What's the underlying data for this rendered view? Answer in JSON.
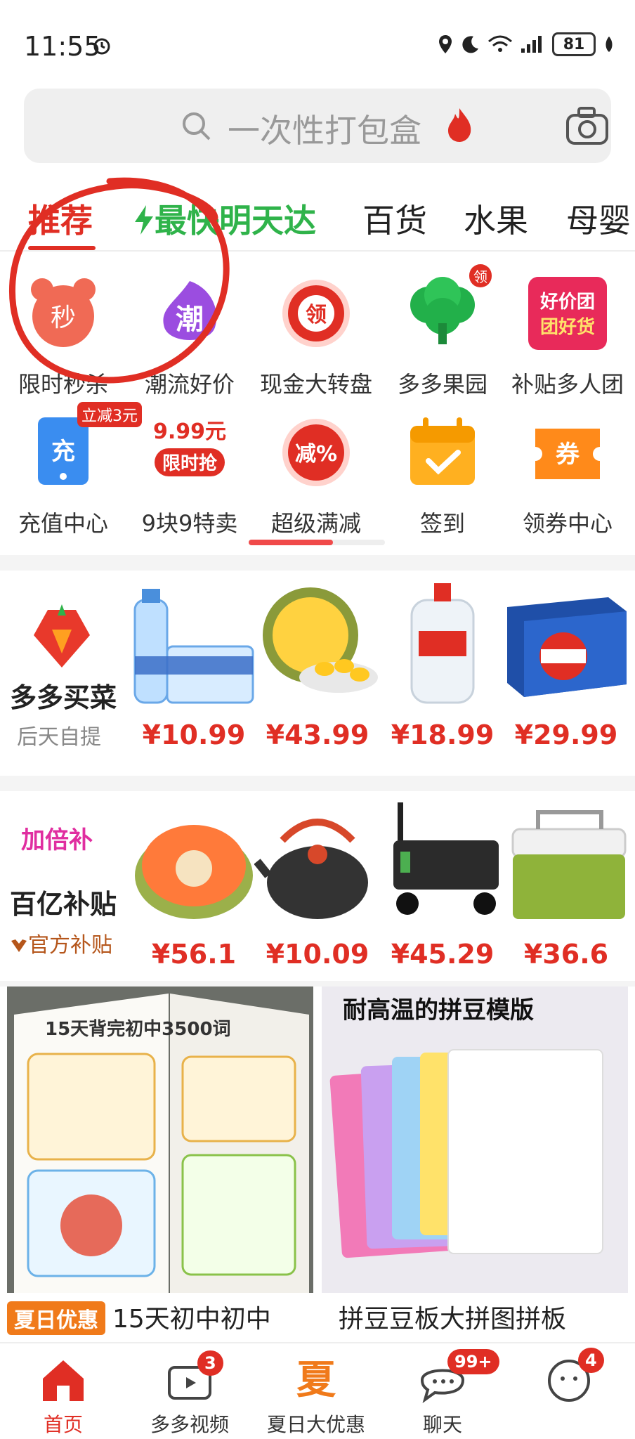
{
  "status_bar": {
    "time": "11:55",
    "battery": "81"
  },
  "search": {
    "placeholder": "一次性打包盒"
  },
  "tabs": [
    {
      "label": "推荐"
    },
    {
      "label": "最快明天达"
    },
    {
      "label": "百货"
    },
    {
      "label": "水果"
    },
    {
      "label": "母婴"
    }
  ],
  "grid_row1": [
    {
      "label": "限时秒杀",
      "icon": "seckill-clock-icon",
      "glyph": "秒"
    },
    {
      "label": "潮流好价",
      "icon": "trend-icon",
      "glyph": "潮"
    },
    {
      "label": "现金大转盘",
      "icon": "wheel-icon",
      "glyph": "领"
    },
    {
      "label": "多多果园",
      "icon": "tree-icon",
      "badge": "领"
    },
    {
      "label": "补贴多人团",
      "icon": "group-buy-icon",
      "glyph_line1": "好价团",
      "glyph_line2": "团好货"
    }
  ],
  "grid_row2": [
    {
      "label": "充值中心",
      "icon": "recharge-icon",
      "glyph": "充",
      "badge": "立减3元"
    },
    {
      "label": "9块9特卖",
      "icon": "sale-icon",
      "glyph_line1": "9.99元",
      "glyph_line2": "限时抢"
    },
    {
      "label": "超级满减",
      "icon": "discount-icon",
      "glyph": "减%"
    },
    {
      "label": "签到",
      "icon": "calendar-check-icon"
    },
    {
      "label": "领券中心",
      "icon": "coupon-icon",
      "glyph": "券"
    }
  ],
  "grocery_row": {
    "title": "多多买菜",
    "subtitle": "后天自提",
    "products": [
      {
        "price": "¥10.99",
        "icon": "water-bottles-icon"
      },
      {
        "price": "¥43.99",
        "icon": "jackfruit-icon"
      },
      {
        "price": "¥18.99",
        "icon": "water-jug-icon"
      },
      {
        "price": "¥29.99",
        "icon": "cola-box-icon"
      }
    ]
  },
  "subsidy_row": {
    "badge_text": "加倍补",
    "title": "百亿补贴",
    "subtitle": "官方补贴",
    "products": [
      {
        "price": "¥56.1",
        "icon": "jackfruit-cut-icon"
      },
      {
        "price": "¥10.09",
        "icon": "kettle-icon"
      },
      {
        "price": "¥45.29",
        "icon": "wagon-icon"
      },
      {
        "price": "¥36.6",
        "icon": "cooler-box-icon"
      }
    ]
  },
  "cards": [
    {
      "tag": "夏日优惠",
      "title": "15天初中初中",
      "image_text": "15天背完初中3500词"
    },
    {
      "tag": "",
      "title": "拼豆豆板大拼图拼板",
      "image_text": "耐高温的拼豆模版"
    }
  ],
  "bottom_nav": [
    {
      "label": "首页",
      "icon": "home-icon"
    },
    {
      "label": "多多视频",
      "icon": "video-icon",
      "badge": "3"
    },
    {
      "label": "夏日大优惠",
      "icon": "summer-icon",
      "glyph": "夏"
    },
    {
      "label": "聊天",
      "icon": "chat-icon",
      "badge": "99+"
    },
    {
      "label": "",
      "icon": "profile-icon",
      "badge": "4"
    }
  ],
  "colors": {
    "accent": "#e02e24",
    "green": "#2fb34a",
    "orange": "#f07a1a"
  }
}
